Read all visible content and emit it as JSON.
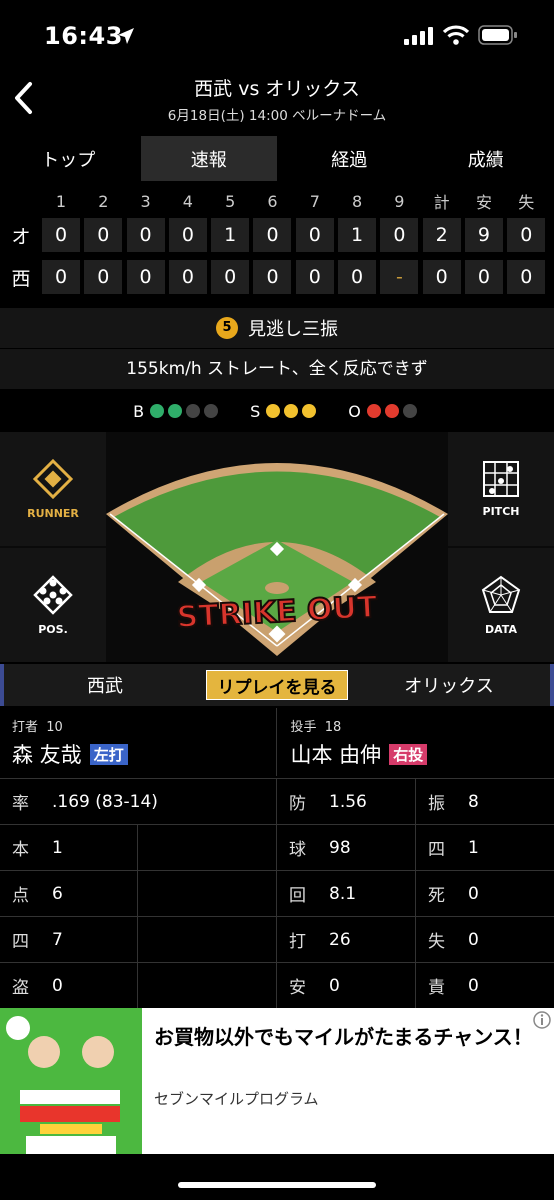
{
  "status": {
    "time": "16:43"
  },
  "header": {
    "title": "西武 vs オリックス",
    "subtitle": "6月18日(土) 14:00 ベルーナドーム"
  },
  "tabs": [
    "トップ",
    "速報",
    "経過",
    "成績"
  ],
  "active_tab": "速報",
  "scoreboard": {
    "columns": [
      "1",
      "2",
      "3",
      "4",
      "5",
      "6",
      "7",
      "8",
      "9",
      "計",
      "安",
      "失"
    ],
    "rows": [
      {
        "team": "オ",
        "cells": [
          "0",
          "0",
          "0",
          "0",
          "1",
          "0",
          "0",
          "1",
          "0",
          "2",
          "9",
          "0"
        ]
      },
      {
        "team": "西",
        "cells": [
          "0",
          "0",
          "0",
          "0",
          "0",
          "0",
          "0",
          "0",
          "-",
          "0",
          "0",
          "0"
        ]
      }
    ]
  },
  "play": {
    "inning": "5",
    "result": "見逃し三振",
    "description": "155km/h ストレート、全く反応できず"
  },
  "count": {
    "b_label": "B",
    "s_label": "S",
    "o_label": "O",
    "balls": 2,
    "strikes": 3,
    "outs": 2,
    "ball_color": "#2fae6a",
    "strike_color": "#f2c12e",
    "out_color": "#e23b2e"
  },
  "field": {
    "runner_label": "RUNNER",
    "pitch_label": "PITCH",
    "pos_label": "POS.",
    "data_label": "DATA",
    "strikeout_text": "STRIKE OUT"
  },
  "teambar": {
    "home": "西武",
    "replay": "リプレイを見る",
    "away": "オリックス"
  },
  "batter": {
    "role": "打者",
    "number": "10",
    "name": "森 友哉",
    "hand": "左打"
  },
  "pitcher": {
    "role": "投手",
    "number": "18",
    "name": "山本 由伸",
    "hand": "右投"
  },
  "batter_stats": [
    {
      "k": "率",
      "v": ".169 (83-14)"
    },
    {
      "k": "本",
      "v": "1"
    },
    {
      "k": "点",
      "v": "6"
    },
    {
      "k": "四",
      "v": "7"
    },
    {
      "k": "盗",
      "v": "0"
    }
  ],
  "pitcher_stats": [
    {
      "k": "防",
      "v": "1.56",
      "k2": "振",
      "v2": "8"
    },
    {
      "k": "球",
      "v": "98",
      "k2": "四",
      "v2": "1"
    },
    {
      "k": "回",
      "v": "8.1",
      "k2": "死",
      "v2": "0"
    },
    {
      "k": "打",
      "v": "26",
      "k2": "失",
      "v2": "0"
    },
    {
      "k": "安",
      "v": "0",
      "k2": "責",
      "v2": "0"
    }
  ],
  "ad": {
    "headline": "お買物以外でもマイルがたまるチャンス！",
    "sponsor": "セブンマイルプログラム"
  }
}
